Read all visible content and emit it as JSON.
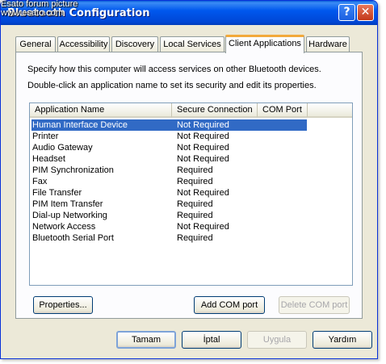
{
  "watermark": {
    "line1": "Esato forum picture",
    "line2": "www.esato.com"
  },
  "window": {
    "title": "Bluetooth Configuration",
    "help_glyph": "?",
    "close_glyph": "✕"
  },
  "tabs": [
    "General",
    "Accessibility",
    "Discovery",
    "Local Services",
    "Client Applications",
    "Hardware"
  ],
  "active_tab": "Client Applications",
  "panel": {
    "description_1": "Specify how this computer will access services on other Bluetooth devices.",
    "description_2": "Double-click an application name to set its security and edit its properties."
  },
  "list": {
    "columns": [
      "Application Name",
      "Secure Connection",
      "COM Port"
    ],
    "rows": [
      {
        "name": "Human Interface Device",
        "secure": "Not Required",
        "com": ""
      },
      {
        "name": "Printer",
        "secure": "Not Required",
        "com": ""
      },
      {
        "name": "Audio Gateway",
        "secure": "Not Required",
        "com": ""
      },
      {
        "name": "Headset",
        "secure": "Not Required",
        "com": ""
      },
      {
        "name": "PIM Synchronization",
        "secure": "Required",
        "com": ""
      },
      {
        "name": "Fax",
        "secure": "Required",
        "com": ""
      },
      {
        "name": "File Transfer",
        "secure": "Not Required",
        "com": ""
      },
      {
        "name": "PIM Item Transfer",
        "secure": "Required",
        "com": ""
      },
      {
        "name": "Dial-up Networking",
        "secure": "Required",
        "com": ""
      },
      {
        "name": "Network Access",
        "secure": "Not Required",
        "com": ""
      },
      {
        "name": "Bluetooth Serial Port",
        "secure": "Required",
        "com": ""
      }
    ],
    "selected_row": "Human Interface Device"
  },
  "panel_buttons": {
    "properties": "Properties...",
    "add_com": "Add COM port",
    "delete_com": "Delete COM port"
  },
  "dialog_buttons": {
    "ok": "Tamam",
    "cancel": "İptal",
    "apply": "Uygula",
    "help": "Yardım"
  },
  "colors": {
    "titlebar": "#0058ee",
    "selection": "#316ac5",
    "active_tab_accent": "#f2a93b",
    "dialog_bg": "#ece9d8"
  }
}
